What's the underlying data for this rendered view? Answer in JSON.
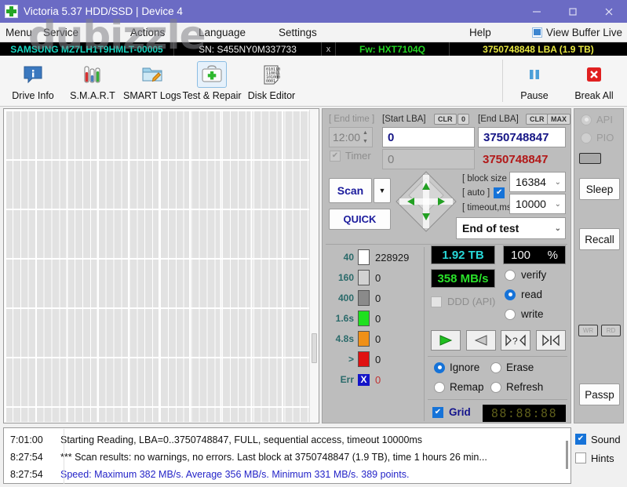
{
  "window": {
    "title": "Victoria 5.37 HDD/SSD | Device 4",
    "app_icon": "cross-medical-icon",
    "minimize": "minimize-icon",
    "maximize": "maximize-icon",
    "close": "close-icon"
  },
  "watermark": {
    "text": "dubizzle"
  },
  "menubar": {
    "items": [
      {
        "label": "Menu"
      },
      {
        "label": "Service"
      },
      {
        "label": "Actions"
      },
      {
        "label": "Language"
      },
      {
        "label": "Settings"
      },
      {
        "label": "Help"
      }
    ],
    "view_buffer": {
      "label": "View Buffer Live",
      "icon": "list-lines-icon"
    }
  },
  "drive_bar": {
    "model": "SAMSUNG MZ7LH1T9HMLT-00005",
    "serial": "SN: S455NY0M337733",
    "close_mark": "x",
    "firmware": "Fw: HXT7104Q",
    "capacity": "3750748848 LBA (1.9 TB)",
    "colors": {
      "model": "#16d6c0",
      "serial": "#f0f0f0",
      "firmware": "#22d422",
      "capacity": "#e8e840"
    }
  },
  "toolbar": {
    "left": [
      {
        "label": "Drive Info",
        "icon": "info-speech-bubble-icon",
        "selected": false
      },
      {
        "label": "S.M.A.R.T",
        "icon": "test-tubes-icon",
        "selected": false
      },
      {
        "label": "SMART Logs",
        "icon": "folder-pencil-icon",
        "selected": false
      },
      {
        "label": "Test & Repair",
        "icon": "first-aid-kit-icon",
        "selected": true
      },
      {
        "label": "Disk Editor",
        "icon": "binary-page-icon",
        "selected": false
      }
    ],
    "right": [
      {
        "label": "Pause",
        "icon": "pause-icon"
      },
      {
        "label": "Break All",
        "icon": "red-x-icon"
      }
    ]
  },
  "controls": {
    "end_time_label": "[ End time ]",
    "end_time_value": "12:00",
    "timer_label": "Timer",
    "timer_checked": true,
    "start_lba_label": "[Start LBA]",
    "start_lba_clr": "CLR",
    "start_lba_zero": "0",
    "start_lba_value": "0",
    "start_lba_second": "0",
    "end_lba_label": "[End LBA]",
    "end_lba_clr": "CLR",
    "end_lba_max": "MAX",
    "end_lba_value": "3750748847",
    "end_lba_second": "3750748847",
    "scan_button": "Scan",
    "quick_button": "QUICK",
    "dpad": "direction-pad",
    "block_size_label": "[ block size ]",
    "auto_label": "[ auto ]",
    "auto_checked": true,
    "timeout_label": "[ timeout,ms ]",
    "block_size_value": "16384",
    "timeout_value": "10000",
    "end_of_test_value": "End of test"
  },
  "legend": {
    "rows": [
      {
        "time": "40",
        "color": "#ffffff",
        "count": "228929"
      },
      {
        "time": "160",
        "color": "#d2d2d2",
        "count": "0"
      },
      {
        "time": "400",
        "color": "#8a8a8a",
        "count": "0"
      },
      {
        "time": "1.6s",
        "color": "#1ee01e",
        "count": "0"
      },
      {
        "time": "4.8s",
        "color": "#f09018",
        "count": "0"
      },
      {
        "time": ">",
        "color": "#e01010",
        "count": "0"
      }
    ],
    "error_label": "Err",
    "error_mark": "X",
    "error_count": "0"
  },
  "stats": {
    "size_lcd": "1.92 TB",
    "percent_lcd": "100",
    "percent_unit": "%",
    "speed_lcd": "358 MB/s",
    "ddd_label": "DDD (API)",
    "ddd_checked": false,
    "modes": [
      {
        "label": "verify",
        "selected": false
      },
      {
        "label": "read",
        "selected": true
      },
      {
        "label": "write",
        "selected": false
      }
    ]
  },
  "transport": [
    {
      "icon": "play-forward-icon"
    },
    {
      "icon": "play-reverse-icon"
    },
    {
      "icon": "step-query-icon"
    },
    {
      "icon": "skip-start-icon"
    }
  ],
  "error_actions": [
    {
      "label": "Ignore",
      "selected": true
    },
    {
      "label": "Erase",
      "selected": false
    },
    {
      "label": "Remap",
      "selected": false
    },
    {
      "label": "Refresh",
      "selected": false
    }
  ],
  "grid_row": {
    "label": "Grid",
    "checked": true,
    "timer_display": "88:88:88"
  },
  "right_strip": {
    "api_label": "API",
    "api_selected": true,
    "pio_label": "PIO",
    "pio_selected": false,
    "sleep_button": "Sleep",
    "recall_button": "Recall",
    "mini_left": "WR",
    "mini_right": "RD",
    "passp_button": "Passp"
  },
  "log": {
    "entries": [
      {
        "time": "7:01:00",
        "message": "Starting Reading, LBA=0..3750748847, FULL, sequential access, timeout 10000ms",
        "style": "normal"
      },
      {
        "time": "8:27:54",
        "message": "*** Scan results: no warnings, no errors. Last block at 3750748847 (1.9 TB), time 1 hours 26 min...",
        "style": "normal"
      },
      {
        "time": "8:27:54",
        "message": "Speed: Maximum 382 MB/s. Average 356 MB/s. Minimum 331 MB/s. 389 points.",
        "style": "blue"
      }
    ]
  },
  "bottom_options": [
    {
      "label": "Sound",
      "checked": true
    },
    {
      "label": "Hints",
      "checked": false
    }
  ]
}
